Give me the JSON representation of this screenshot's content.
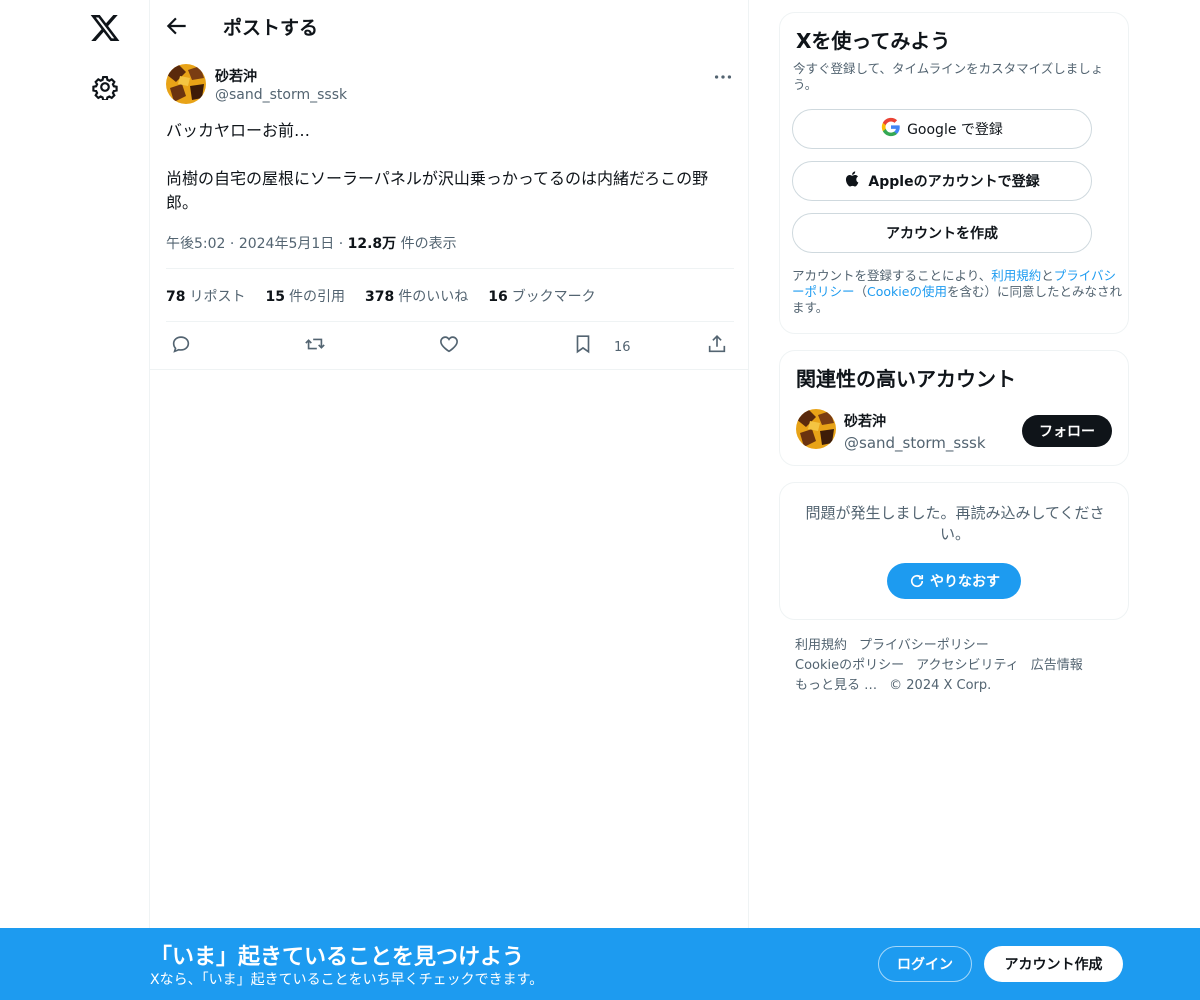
{
  "header": {
    "title": "ポストする"
  },
  "post": {
    "author_name": "砂若沖",
    "author_handle": "@sand_storm_sssk",
    "text": "バッカヤローお前…\n\n尚樹の自宅の屋根にソーラーパネルが沢山乗っかってるのは内緒だろこの野郎。",
    "time": "午後5:02",
    "date": "2024年5月1日",
    "views_count": "12.8万",
    "views_label": "件の表示",
    "stats": {
      "reposts_count": "78",
      "reposts_label": "リポスト",
      "quotes_count": "15",
      "quotes_label": "件の引用",
      "likes_count": "378",
      "likes_label": "件のいいね",
      "bookmarks_count": "16",
      "bookmarks_label": "ブックマーク"
    },
    "bookmark_action_count": "16"
  },
  "signup_card": {
    "title": "Xを使ってみよう",
    "description": "今すぐ登録して、タイムラインをカスタマイズしましょう。",
    "google_button": "Google で登録",
    "apple_button": "Appleのアカウントで登録",
    "create_button": "アカウントを作成",
    "terms_prefix": "アカウントを登録することにより、",
    "terms_link": "利用規約",
    "terms_and": "と",
    "privacy_link": "プライバシーポリシー",
    "terms_paren_open": "（",
    "cookie_link": "Cookieの使用",
    "terms_suffix": "を含む）に同意したとみなされます。"
  },
  "related_card": {
    "title": "関連性の高いアカウント",
    "name": "砂若沖",
    "handle": "@sand_storm_sssk",
    "follow_button": "フォロー"
  },
  "error_card": {
    "message": "問題が発生しました。再読み込みしてください。",
    "retry_button": "やりなおす"
  },
  "footer": {
    "terms": "利用規約",
    "privacy": "プライバシーポリシー",
    "cookie": "Cookieのポリシー",
    "accessibility": "アクセシビリティ",
    "ads": "広告情報",
    "more": "もっと見る …",
    "copyright": "© 2024 X Corp."
  },
  "bottom_bar": {
    "title": "「いま」起きていることを見つけよう",
    "subtitle": "Xなら、「いま」起きていることをいち早くチェックできます。",
    "login_button": "ログイン",
    "signup_button": "アカウント作成"
  },
  "colors": {
    "accent": "#1d9bf0",
    "text": "#0f1419",
    "muted": "#536471",
    "border": "#eff3f4"
  }
}
